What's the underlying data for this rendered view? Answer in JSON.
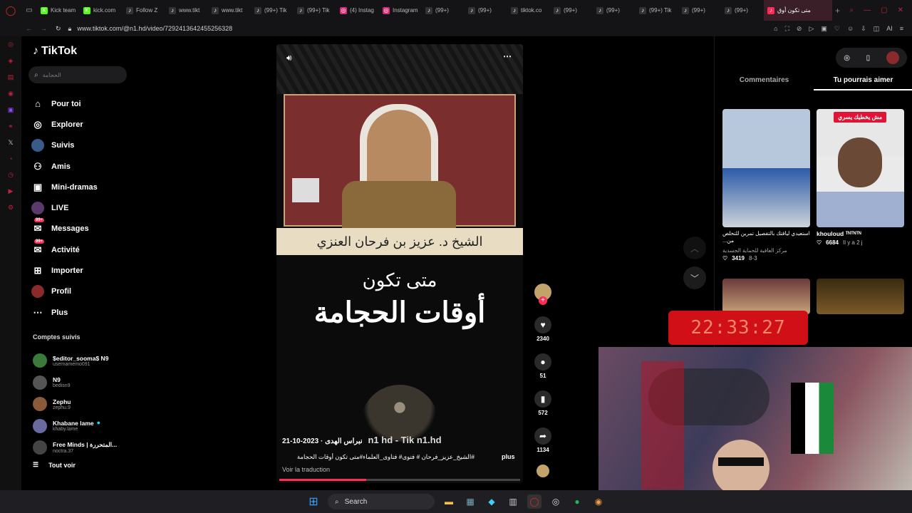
{
  "browser": {
    "tabs": [
      {
        "label": "Kick team",
        "icon": "kick-icon",
        "color": "#53fc18"
      },
      {
        "label": "kick.com",
        "icon": "kick-icon",
        "color": "#53fc18"
      },
      {
        "label": "Follow Z",
        "icon": "tiktok-icon",
        "color": "#333"
      },
      {
        "label": "www.tikt",
        "icon": "tiktok-icon",
        "color": "#333"
      },
      {
        "label": "www.tikt",
        "icon": "tiktok-icon",
        "color": "#333"
      },
      {
        "label": "(99+) Tik",
        "icon": "tiktok-icon",
        "color": "#333"
      },
      {
        "label": "(99+) Tik",
        "icon": "tiktok-icon",
        "color": "#333"
      },
      {
        "label": "(4) Instag",
        "icon": "instagram-icon",
        "color": "#d62976"
      },
      {
        "label": "Instagram",
        "icon": "instagram-icon",
        "color": "#d62976"
      },
      {
        "label": "(99+)",
        "icon": "tiktok-icon",
        "color": "#333"
      },
      {
        "label": "(99+)",
        "icon": "tiktok-icon",
        "color": "#333"
      },
      {
        "label": "tiktok.co",
        "icon": "tiktok-icon",
        "color": "#333"
      },
      {
        "label": "(99+)",
        "icon": "tiktok-icon",
        "color": "#333"
      },
      {
        "label": "(99+)",
        "icon": "tiktok-icon",
        "color": "#333"
      },
      {
        "label": "(99+) Tik",
        "icon": "tiktok-icon",
        "color": "#333"
      },
      {
        "label": "(99+)",
        "icon": "tiktok-icon",
        "color": "#333"
      },
      {
        "label": "(99+)",
        "icon": "tiktok-icon",
        "color": "#333"
      }
    ],
    "active_tab": "متى تكون أوق",
    "url": "www.tiktok.com/@n1.hd/video/7292413642455256328"
  },
  "sidebar": {
    "logo": "TikTok",
    "search_placeholder": "الحجامة",
    "nav": [
      {
        "label": "Pour toi",
        "icon": "home-icon"
      },
      {
        "label": "Explorer",
        "icon": "compass-icon"
      },
      {
        "label": "Suivis",
        "icon": "following-avatar"
      },
      {
        "label": "Amis",
        "icon": "friends-icon"
      },
      {
        "label": "Mini-dramas",
        "icon": "clapper-icon"
      },
      {
        "label": "LIVE",
        "icon": "live-avatar"
      },
      {
        "label": "Messages",
        "icon": "inbox-icon",
        "badge": "99+"
      },
      {
        "label": "Activité",
        "icon": "activity-icon",
        "badge": "99+"
      },
      {
        "label": "Importer",
        "icon": "upload-icon"
      },
      {
        "label": "Profil",
        "icon": "profile-avatar"
      },
      {
        "label": "Plus",
        "icon": "more-icon"
      }
    ],
    "following_title": "Comptes suivis",
    "following": [
      {
        "name": "$editor_sooma$ N9",
        "user": "usernamemo091",
        "color": "#3a7a3a"
      },
      {
        "name": "N9",
        "user": "bedisn9",
        "color": "#555"
      },
      {
        "name": "Zephu",
        "user": "zephu.9",
        "color": "#8a5a3a"
      },
      {
        "name": "Khabane lame",
        "user": "khaby.lame",
        "color": "#6a6aa0",
        "verified": true
      },
      {
        "name": "Free Minds | المتحررة...",
        "user": "noctra.37",
        "color": "#444"
      }
    ],
    "see_all": "Tout voir"
  },
  "video": {
    "banner_text": "الشيخ د. عزيز بن فرحان العنزي",
    "title_line1": "متى تكون",
    "title_line2": "أوقات الحجامة",
    "watermark": "n1 hd - Tik n1.hd",
    "author": "نبراس الهدى · 2023-10-21",
    "description": "#الشيخ_عزيز_فرحان # فتوى# فتاوى_العلماء#متى تكون أوقات الحجامة",
    "more": "plus",
    "translate": "Voir la traduction",
    "progress": 0.36
  },
  "actions": {
    "likes": "2340",
    "comments": "51",
    "saves": "572",
    "shares": "1134"
  },
  "right_panel": {
    "tab_comments": "Commentaires",
    "tab_suggestions": "Tu pourrais aimer",
    "cards": [
      {
        "title": "استعيدي لياقتك بالتفصيل تمرين للتخلص من...",
        "author": "مركز العافية للحماية الجسدية",
        "likes": "3419",
        "date": "8-3"
      },
      {
        "title": "khouloud ᵀᴺᵀᴺᵀᴺ",
        "author": "",
        "likes": "6684",
        "date": "Il y a 2 j",
        "overlay": "مش يخطيك يسري"
      }
    ]
  },
  "overlay_clock": "22:33:27",
  "taskbar": {
    "search": "Search"
  }
}
